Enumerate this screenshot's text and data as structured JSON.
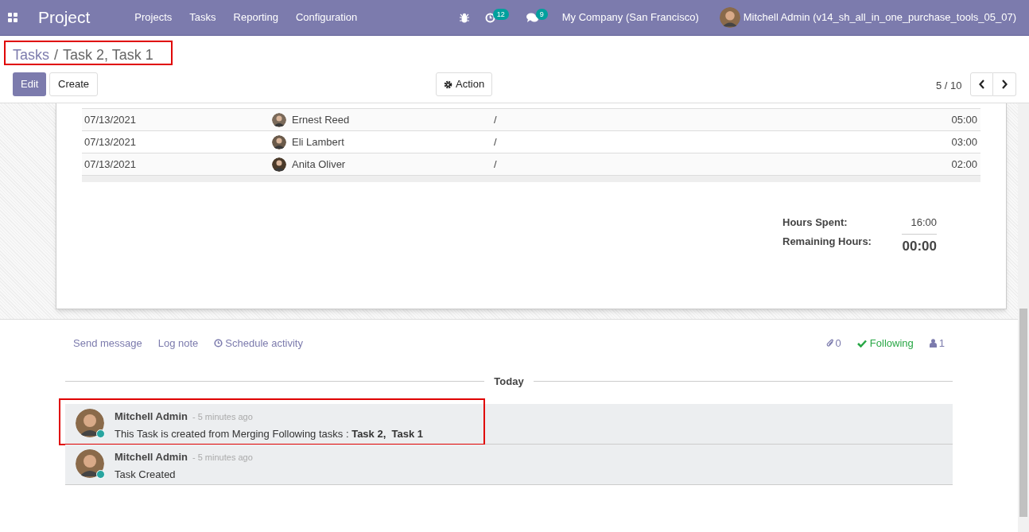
{
  "navbar": {
    "app_name": "Project",
    "menu": [
      "Projects",
      "Tasks",
      "Reporting",
      "Configuration"
    ],
    "activity_count": "12",
    "message_count": "9",
    "company": "My Company (San Francisco)",
    "user": "Mitchell Admin (v14_sh_all_in_one_purchase_tools_05_07)"
  },
  "breadcrumb": {
    "parent": "Tasks",
    "separator": "/",
    "current": "Task 2, Task 1",
    "highlighted": true
  },
  "buttons": {
    "edit": "Edit",
    "create": "Create",
    "action": "Action"
  },
  "pager": {
    "value": "5 / 10"
  },
  "timesheet_rows": [
    {
      "date": "07/13/2021",
      "employee": "Ernest Reed",
      "description": "/",
      "duration": "05:00"
    },
    {
      "date": "07/13/2021",
      "employee": "Eli Lambert",
      "description": "/",
      "duration": "03:00"
    },
    {
      "date": "07/13/2021",
      "employee": "Anita Oliver",
      "description": "/",
      "duration": "02:00"
    }
  ],
  "totals": [
    {
      "label": "Hours Spent:",
      "value": "16:00",
      "kind": "plain"
    },
    {
      "label": "Remaining Hours:",
      "value": "00:00",
      "kind": "total"
    }
  ],
  "chatter": {
    "actions": [
      "Send message",
      "Log note",
      "Schedule activity"
    ],
    "attachments": "0",
    "follow": "Following",
    "followers": "1",
    "date_separator": "Today",
    "messages": [
      {
        "author": "Mitchell Admin",
        "time": "- 5 minutes ago",
        "body": "This Task is created from Merging Following tasks : **Task 2,  Task 1**",
        "highlighted": true
      },
      {
        "author": "Mitchell Admin",
        "time": "- 5 minutes ago",
        "body": "Task Created",
        "highlighted": false
      }
    ]
  }
}
